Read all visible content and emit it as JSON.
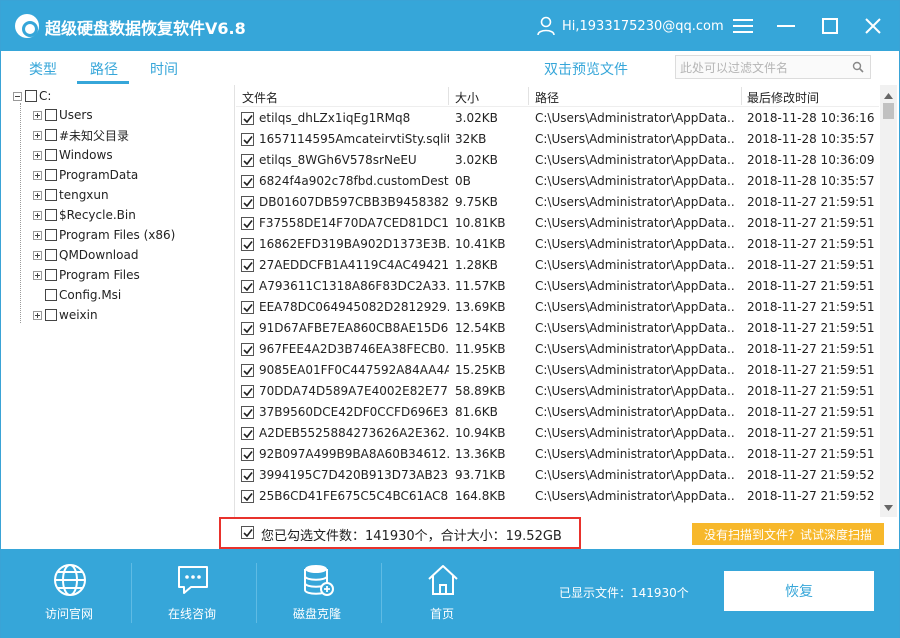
{
  "app": {
    "title": "超级硬盘数据恢复软件V6.8",
    "user": "Hi,1933175230@qq.com"
  },
  "tabs": [
    {
      "label": "类型"
    },
    {
      "label": "路径"
    },
    {
      "label": "时间"
    }
  ],
  "toolbar": {
    "preview_label": "双击预览文件",
    "filter_placeholder": "此处可以过滤文件名"
  },
  "tree": {
    "root": "C:",
    "children": [
      {
        "label": "Users",
        "expandable": true
      },
      {
        "label": "#未知父目录",
        "expandable": true
      },
      {
        "label": "Windows",
        "expandable": true
      },
      {
        "label": "ProgramData",
        "expandable": true
      },
      {
        "label": "tengxun",
        "expandable": true
      },
      {
        "label": "$Recycle.Bin",
        "expandable": true
      },
      {
        "label": "Program Files (x86)",
        "expandable": true
      },
      {
        "label": "QMDownload",
        "expandable": true
      },
      {
        "label": "Program Files",
        "expandable": true
      },
      {
        "label": "Config.Msi",
        "expandable": false
      },
      {
        "label": "weixin",
        "expandable": true
      }
    ]
  },
  "table": {
    "headers": {
      "name": "文件名",
      "size": "大小",
      "path": "路径",
      "time": "最后修改时间"
    },
    "rows": [
      {
        "name": "etilqs_dhLZx1iqEg1RMq8",
        "size": "3.02KB",
        "path": "C:\\Users\\Administrator\\AppData...",
        "time": "2018-11-28 10:36:16"
      },
      {
        "name": "1657114595AmcateirvtiSty.sqlit...",
        "size": "32KB",
        "path": "C:\\Users\\Administrator\\AppData...",
        "time": "2018-11-28 10:35:57"
      },
      {
        "name": "etilqs_8WGh6V578srNeEU",
        "size": "3.02KB",
        "path": "C:\\Users\\Administrator\\AppData...",
        "time": "2018-11-28 10:36:09"
      },
      {
        "name": "6824f4a902c78fbd.customDest...",
        "size": "0B",
        "path": "C:\\Users\\Administrator\\AppData...",
        "time": "2018-11-28 10:35:57"
      },
      {
        "name": "DB01607DB597CBB3B9458382...",
        "size": "9.75KB",
        "path": "C:\\Users\\Administrator\\AppData...",
        "time": "2018-11-27 21:59:51"
      },
      {
        "name": "F37558DE14F70DA7CED81DC1...",
        "size": "10.81KB",
        "path": "C:\\Users\\Administrator\\AppData...",
        "time": "2018-11-27 21:59:51"
      },
      {
        "name": "16862EFD319BA902D1373E3B...",
        "size": "10.41KB",
        "path": "C:\\Users\\Administrator\\AppData...",
        "time": "2018-11-27 21:59:51"
      },
      {
        "name": "27AEDDCFB1A4119C4AC49421...",
        "size": "1.28KB",
        "path": "C:\\Users\\Administrator\\AppData...",
        "time": "2018-11-27 21:59:51"
      },
      {
        "name": "A793611C1318A86F83DC2A33...",
        "size": "11.57KB",
        "path": "C:\\Users\\Administrator\\AppData...",
        "time": "2018-11-27 21:59:51"
      },
      {
        "name": "EEA78DC064945082D2812929...",
        "size": "13.69KB",
        "path": "C:\\Users\\Administrator\\AppData...",
        "time": "2018-11-27 21:59:51"
      },
      {
        "name": "91D67AFBE7EA860CB8AE15D6...",
        "size": "12.54KB",
        "path": "C:\\Users\\Administrator\\AppData...",
        "time": "2018-11-27 21:59:51"
      },
      {
        "name": "967FEE4A2D3B746EA38FECB0...",
        "size": "11.95KB",
        "path": "C:\\Users\\Administrator\\AppData...",
        "time": "2018-11-27 21:59:51"
      },
      {
        "name": "9085EA01FF0C447592A84AA4A...",
        "size": "15.25KB",
        "path": "C:\\Users\\Administrator\\AppData...",
        "time": "2018-11-27 21:59:51"
      },
      {
        "name": "70DDA74D589A7E4002E82E77...",
        "size": "58.89KB",
        "path": "C:\\Users\\Administrator\\AppData...",
        "time": "2018-11-27 21:59:51"
      },
      {
        "name": "37B9560DCE42DF0CCFD696E3...",
        "size": "81.6KB",
        "path": "C:\\Users\\Administrator\\AppData...",
        "time": "2018-11-27 21:59:51"
      },
      {
        "name": "A2DEB5525884273626A2E362...",
        "size": "10.94KB",
        "path": "C:\\Users\\Administrator\\AppData...",
        "time": "2018-11-27 21:59:51"
      },
      {
        "name": "92B097A499B9BA8A60B34612...",
        "size": "13.36KB",
        "path": "C:\\Users\\Administrator\\AppData...",
        "time": "2018-11-27 21:59:51"
      },
      {
        "name": "3994195C7D420B913D73AB23...",
        "size": "93.71KB",
        "path": "C:\\Users\\Administrator\\AppData...",
        "time": "2018-11-27 21:59:52"
      },
      {
        "name": "25B6CD41FE675C5C4BC61AC8...",
        "size": "164.8KB",
        "path": "C:\\Users\\Administrator\\AppData...",
        "time": "2018-11-27 21:59:52"
      }
    ]
  },
  "summary": {
    "text": "您已勾选文件数：141930个，合计大小：19.52GB",
    "deep_scan": "没有扫描到文件？试试深度扫描"
  },
  "bottom": {
    "nav": [
      {
        "label": "访问官网",
        "icon": "globe-icon"
      },
      {
        "label": "在线咨询",
        "icon": "chat-icon"
      },
      {
        "label": "磁盘克隆",
        "icon": "database-icon"
      },
      {
        "label": "首页",
        "icon": "home-icon"
      }
    ],
    "shown_files": "已显示文件：141930个",
    "recover_label": "恢复"
  },
  "colors": {
    "accent": "#36a6d9",
    "highlight_border": "#e8322c",
    "deep_scan_bg": "#f7b82b"
  }
}
